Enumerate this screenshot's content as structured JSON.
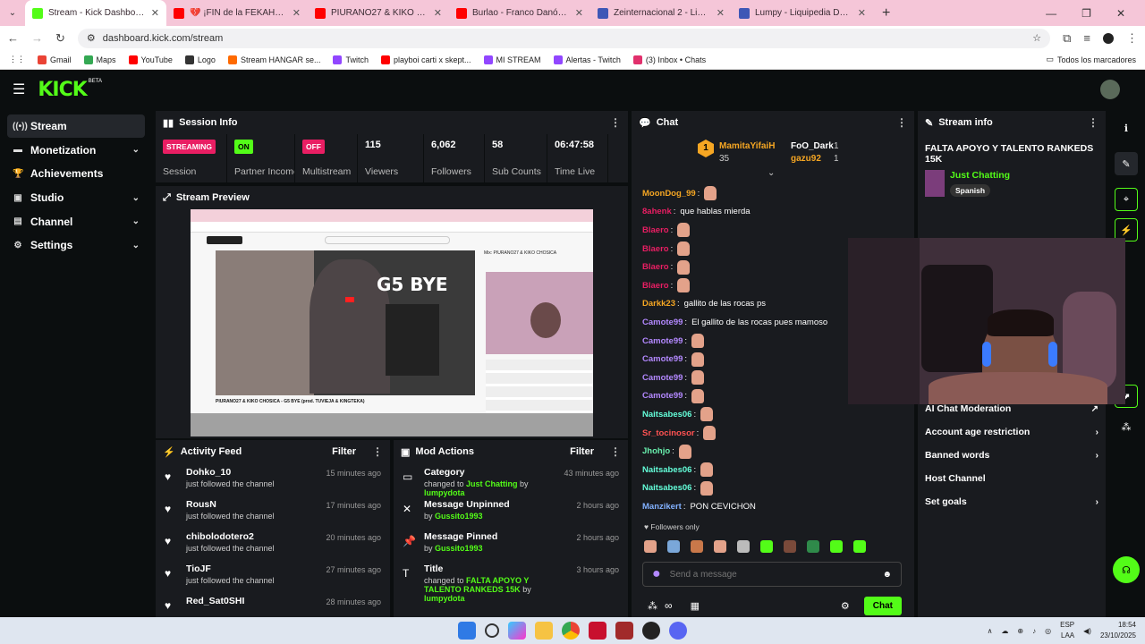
{
  "browser": {
    "tabs": [
      {
        "title": "Stream - Kick Dashboard",
        "color": "#53fc18",
        "active": true
      },
      {
        "title": "💔 ¡FIN de la FEKAHOUSE",
        "color": "#ff0000",
        "active": false
      },
      {
        "title": "PIURANO27 & KIKO CHOSICA",
        "color": "#ff0000",
        "active": false
      },
      {
        "title": "Burlao - Franco Danós 🩸 @N",
        "color": "#ff0000",
        "active": false
      },
      {
        "title": "Zeinternacional 2 - Liquipedia",
        "color": "#3e57b6",
        "active": false
      },
      {
        "title": "Lumpy - Liquipedia Dota 2 Wiki",
        "color": "#3e57b6",
        "active": false
      }
    ],
    "url": "dashboard.kick.com/stream",
    "bookmarks": [
      {
        "label": "Gmail",
        "color": "#ea4335"
      },
      {
        "label": "Maps",
        "color": "#34a853"
      },
      {
        "label": "YouTube",
        "color": "#ff0000"
      },
      {
        "label": "Logo",
        "color": "#333333"
      },
      {
        "label": "Stream HANGAR se...",
        "color": "#ff6a00"
      },
      {
        "label": "Twitch",
        "color": "#9146ff"
      },
      {
        "label": "playboi carti x skept...",
        "color": "#ff0000"
      },
      {
        "label": "MI STREAM",
        "color": "#9146ff"
      },
      {
        "label": "Alertas - Twitch",
        "color": "#9146ff"
      },
      {
        "label": "(3) Inbox • Chats",
        "color": "#e1306c"
      }
    ],
    "all_bookmarks": "Todos los marcadores"
  },
  "header": {
    "logo": "KICK",
    "beta": "BETA"
  },
  "sidebar": {
    "items": [
      {
        "label": "Stream",
        "icon": "broadcast-icon",
        "glyph": "((•))",
        "active": true,
        "chevron": false
      },
      {
        "label": "Monetization",
        "icon": "money-icon",
        "glyph": "▬",
        "active": false,
        "chevron": true
      },
      {
        "label": "Achievements",
        "icon": "trophy-icon",
        "glyph": "🏆",
        "active": false,
        "chevron": false
      },
      {
        "label": "Studio",
        "icon": "studio-icon",
        "glyph": "▣",
        "active": false,
        "chevron": true
      },
      {
        "label": "Channel",
        "icon": "channel-icon",
        "glyph": "▤",
        "active": false,
        "chevron": true
      },
      {
        "label": "Settings",
        "icon": "gear-icon",
        "glyph": "⚙",
        "active": false,
        "chevron": true
      }
    ]
  },
  "session": {
    "title": "Session Info",
    "stats": [
      {
        "badge": "STREAMING",
        "badge_color": "#e91e63",
        "label": "Session"
      },
      {
        "badge": "ON",
        "badge_color": "#53fc18",
        "label": "Partner Income"
      },
      {
        "badge": "OFF",
        "badge_color": "#e91e63",
        "label": "Multistream"
      },
      {
        "num": "115",
        "label": "Viewers"
      },
      {
        "num": "6,062",
        "label": "Followers"
      },
      {
        "num": "58",
        "label": "Sub Counts"
      },
      {
        "num": "06:47:58",
        "label": "Time Live"
      }
    ]
  },
  "preview": {
    "title": "Stream Preview",
    "video_overlay": "G5 BYE",
    "video_title": "PIURANO27 & KIKO CHOSICA - G5 BYE (prod. TUVIEJA & KINGTEKA)",
    "side_title": "Mix: PIURANO27 & KIKO CHOSICA"
  },
  "activity": {
    "title": "Activity Feed",
    "filter": "Filter",
    "items": [
      {
        "name": "Dohko_10",
        "text": "just followed the channel",
        "time": "15 minutes ago"
      },
      {
        "name": "RousN",
        "text": "just followed the channel",
        "time": "17 minutes ago"
      },
      {
        "name": "chibolodotero2",
        "text": "just followed the channel",
        "time": "20 minutes ago"
      },
      {
        "name": "TioJF",
        "text": "just followed the channel",
        "time": "27 minutes ago"
      },
      {
        "name": "Red_Sat0SHI",
        "text": "",
        "time": "28 minutes ago"
      }
    ]
  },
  "mod": {
    "title": "Mod Actions",
    "filter": "Filter",
    "items": [
      {
        "icon": "category-icon",
        "glyph": "▭",
        "action": "Category",
        "pre": "changed to ",
        "highlight": "Just Chatting",
        "mid": " by ",
        "user": "lumpydota",
        "time": "43 minutes ago"
      },
      {
        "icon": "unpin-icon",
        "glyph": "✕",
        "action": "Message Unpinned",
        "pre": "by ",
        "highlight": "",
        "mid": "",
        "user": "Gussito1993",
        "time": "2 hours ago"
      },
      {
        "icon": "pin-icon",
        "glyph": "📌",
        "action": "Message Pinned",
        "pre": "by ",
        "highlight": "",
        "mid": "",
        "user": "Gussito1993",
        "time": "2 hours ago"
      },
      {
        "icon": "title-icon",
        "glyph": "T",
        "action": "Title",
        "pre": "changed to ",
        "highlight": "FALTA APOYO Y TALENTO RANKEDS 15K",
        "mid": " by ",
        "user": "lumpydota",
        "time": "3 hours ago"
      }
    ]
  },
  "chat": {
    "title": "Chat",
    "top": {
      "first_name": "MamitaYifaiH",
      "first_count": "35",
      "second_name": "FoO_Dark",
      "second_count": "1",
      "third_name": "gazu92",
      "third_count": "1"
    },
    "messages": [
      {
        "user": "MoonDog_99",
        "color": "#f5a623",
        "text": "",
        "emote": true
      },
      {
        "user": "8ahenk",
        "color": "#e91e63",
        "text": "que hablas mierda",
        "emote": false
      },
      {
        "user": "Blaero",
        "color": "#e91e63",
        "text": "",
        "emote": true
      },
      {
        "user": "Blaero",
        "color": "#e91e63",
        "text": "",
        "emote": true
      },
      {
        "user": "Blaero",
        "color": "#e91e63",
        "text": "",
        "emote": true
      },
      {
        "user": "Blaero",
        "color": "#e91e63",
        "text": "",
        "emote": true
      },
      {
        "user": "Darkk23",
        "color": "#f5a623",
        "text": "gallito de las rocas ps",
        "emote": false
      },
      {
        "user": "Camote99",
        "color": "#b388ff",
        "text": "El gallito de las rocas pues mamoso",
        "emote": false
      },
      {
        "user": "Camote99",
        "color": "#b388ff",
        "text": "",
        "emote": true
      },
      {
        "user": "Camote99",
        "color": "#b388ff",
        "text": "",
        "emote": true
      },
      {
        "user": "Camote99",
        "color": "#b388ff",
        "text": "",
        "emote": true
      },
      {
        "user": "Camote99",
        "color": "#b388ff",
        "text": "",
        "emote": true
      },
      {
        "user": "Naitsabes06",
        "color": "#64ffda",
        "text": "",
        "emote": true
      },
      {
        "user": "Sr_tocinosor",
        "color": "#ff5252",
        "text": "",
        "emote": true
      },
      {
        "user": "Jhohjo",
        "color": "#69f0ae",
        "text": "",
        "emote": true
      },
      {
        "user": "Naitsabes06",
        "color": "#64ffda",
        "text": "",
        "emote": true
      },
      {
        "user": "Naitsabes06",
        "color": "#64ffda",
        "text": "",
        "emote": true
      },
      {
        "user": "Manzikert",
        "color": "#82b1ff",
        "text": "PON CEVICHON",
        "emote": false
      }
    ],
    "followers_only": "Followers only",
    "placeholder": "Send a message",
    "send": "Chat",
    "infinity": "∞"
  },
  "stream_info": {
    "title": "Stream info",
    "stream_title": "FALTA APOYO Y TALENTO RANKEDS 15K",
    "category": "Just Chatting",
    "tag": "Spanish",
    "items": [
      {
        "label": "AI Chat Moderation",
        "chevron": "↗"
      },
      {
        "label": "Account age restriction",
        "chevron": "›"
      },
      {
        "label": "Banned words",
        "chevron": "›"
      },
      {
        "label": "Host Channel",
        "chevron": ""
      },
      {
        "label": "Set goals",
        "chevron": "›"
      }
    ]
  },
  "taskbar": {
    "lang": "ESP",
    "layout": "LAA",
    "time": "18:54",
    "date": "23/10/2025"
  },
  "colors": {
    "accent": "#53fc18",
    "panel": "#191b1f",
    "bg": "#0b0e0f"
  }
}
